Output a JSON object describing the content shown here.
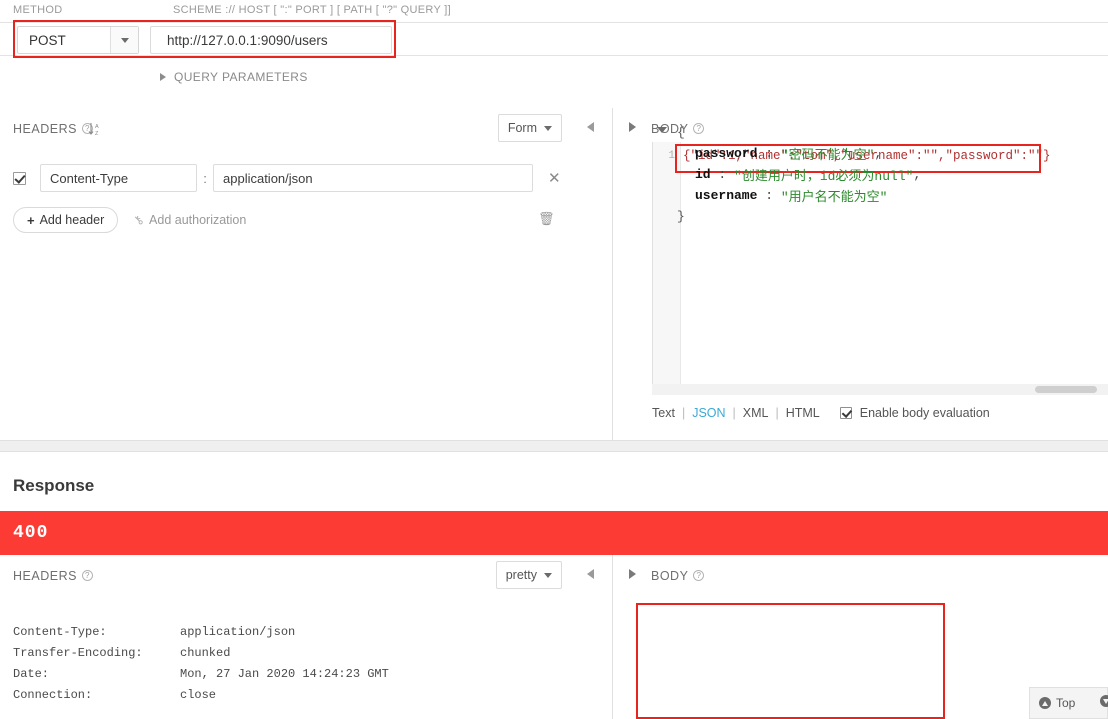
{
  "request": {
    "labels": {
      "method": "METHOD",
      "scheme": "SCHEME :// HOST [ \":\" PORT ] [ PATH [ \"?\" QUERY ]]"
    },
    "method": "POST",
    "url": "http://127.0.0.1:9090/users",
    "query_parameters_label": "QUERY PARAMETERS",
    "headers_section": {
      "title": "HEADERS",
      "help_icon": "help-circle-icon",
      "sort_icon": "sort-az-icon",
      "format_button": "Form",
      "rows": [
        {
          "enabled": true,
          "key": "Content-Type",
          "separator": ":",
          "value": "application/json",
          "remove_icon": "close-icon"
        }
      ],
      "add_header_label": "Add header",
      "add_authorization_label": "Add authorization",
      "delete_icon": "trash-icon"
    },
    "body_section": {
      "title": "BODY",
      "help_icon": "help-circle-icon",
      "line_number": "1",
      "content": "{\"id\":1,\"name\":\"tom\",\"username\":\"\",\"password\":\"\"}",
      "formats": [
        "Text",
        "JSON",
        "XML",
        "HTML"
      ],
      "active_format": "JSON",
      "enable_body_evaluation_label": "Enable body evaluation",
      "enable_body_evaluation_checked": true
    }
  },
  "response": {
    "title": "Response",
    "status_code": "400",
    "status_color": "#fc3b34",
    "headers_section": {
      "title": "HEADERS",
      "help_icon": "help-circle-icon",
      "format_button": "pretty",
      "rows": [
        {
          "key": "Content-Type:",
          "value": "application/json"
        },
        {
          "key": "Transfer-Encoding:",
          "value": "chunked"
        },
        {
          "key": "Date:",
          "value": "Mon, 27 Jan 2020 14:24:23 GMT"
        },
        {
          "key": "Connection:",
          "value": "close"
        }
      ]
    },
    "body_section": {
      "title": "BODY",
      "help_icon": "help-circle-icon",
      "open_brace": "{",
      "close_brace": "}",
      "entries": [
        {
          "key": "password",
          "sep": " : ",
          "value": "\"密码不能为空\"",
          "comma": ","
        },
        {
          "key": "id",
          "sep": " : ",
          "value": "\"创建用户时，id必须为null\"",
          "comma": ","
        },
        {
          "key": "username",
          "sep": " : ",
          "value": "\"用户名不能为空\"",
          "comma": ""
        }
      ]
    }
  },
  "footer": {
    "top_label": "Top",
    "top_icon": "arrow-up-circle-icon",
    "bottom_icon": "arrow-down-circle-icon"
  },
  "annotations": {
    "accent_red": "#e8241f"
  }
}
